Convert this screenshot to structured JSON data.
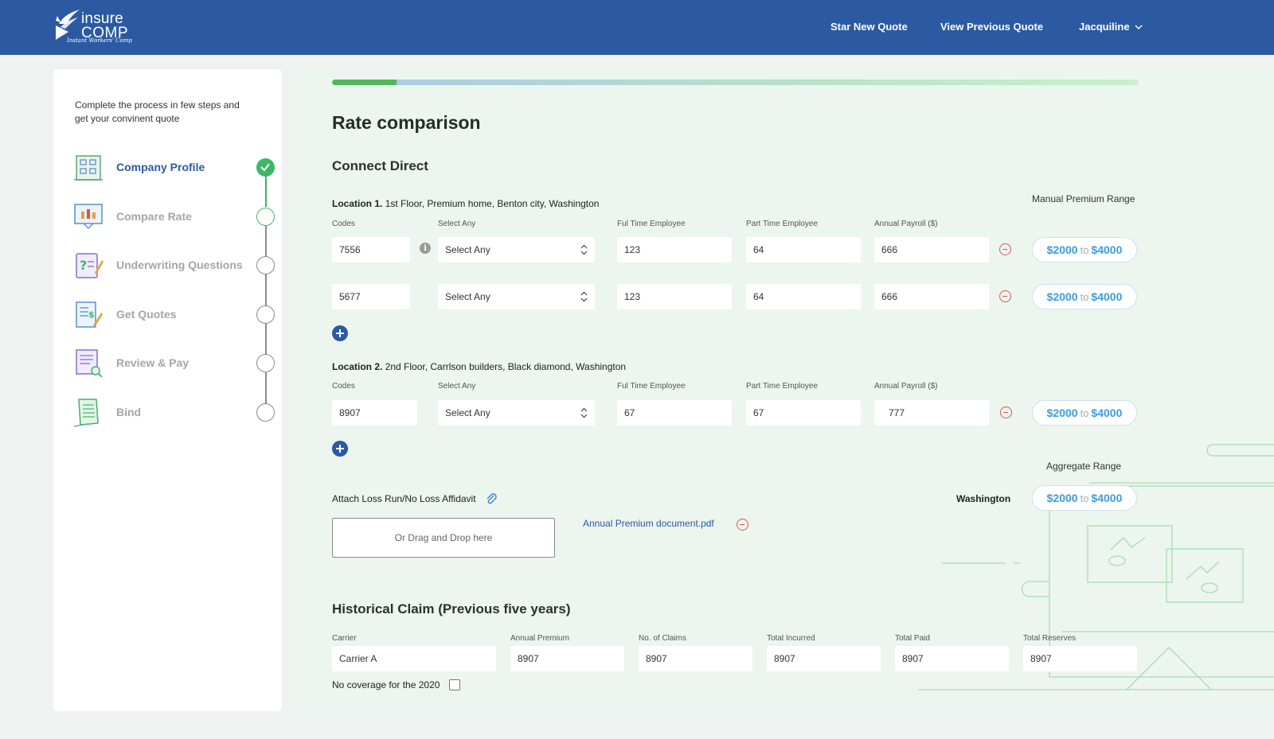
{
  "header": {
    "logo": {
      "top": "insure",
      "bottom": "COMP",
      "tagline": "Instant Workers' Comp"
    },
    "nav": {
      "new_quote": "Star New Quote",
      "prev_quote": "View Previous Quote",
      "user": "Jacquiline"
    }
  },
  "sidebar": {
    "intro": "Complete the process in few steps and get your convinent quote",
    "steps": [
      {
        "label": "Company Profile",
        "status": "completed",
        "icon": "building-icon"
      },
      {
        "label": "Compare Rate",
        "status": "current",
        "icon": "presentation-board-icon"
      },
      {
        "label": "Underwriting Questions",
        "status": "pending",
        "icon": "question-clipboard-icon"
      },
      {
        "label": "Get Quotes",
        "status": "pending",
        "icon": "invoice-pen-icon"
      },
      {
        "label": "Review & Pay",
        "status": "pending",
        "icon": "document-search-icon"
      },
      {
        "label": "Bind",
        "status": "pending",
        "icon": "notebook-icon"
      }
    ]
  },
  "main": {
    "progress_fraction": 0.08,
    "title": "Rate comparison",
    "subtitle": "Connect Direct",
    "manual_premium_range_label": "Manual Premium Range",
    "column_labels": {
      "codes": "Codes",
      "select_any": "Select Any",
      "full_time": "Ful Time Employee",
      "part_time": "Part Time Employee",
      "annual_payroll": "Annual Payroll ($)"
    },
    "locations": [
      {
        "prefix": "Location 1.",
        "address": "1st Floor, Premium home, Benton city, Washington",
        "rows": [
          {
            "code": "7556",
            "select": "Select Any",
            "full_time": "123",
            "part_time": "64",
            "payroll": "666",
            "range_from": "$2000",
            "range_to": "$4000"
          },
          {
            "code": "5677",
            "select": "Select Any",
            "full_time": "123",
            "part_time": "64",
            "payroll": "666",
            "range_from": "$2000",
            "range_to": "$4000"
          }
        ]
      },
      {
        "prefix": "Location 2.",
        "address": "2nd Floor, Carrlson builders, Black diamond, Washington",
        "rows": [
          {
            "code": "8907",
            "select": "Select Any",
            "full_time": "67",
            "part_time": "67",
            "payroll": "777",
            "range_from": "$2000",
            "range_to": "$4000"
          }
        ]
      }
    ],
    "range_connector": "to",
    "aggregate": {
      "label": "Aggregate Range",
      "state": "Washington",
      "from": "$2000",
      "to": "$4000"
    },
    "attach": {
      "label": "Attach Loss Run/No Loss Affidavit",
      "dropzone": "Or Drag and Drop here",
      "file": "Annual Premium document.pdf"
    },
    "historical": {
      "title": "Historical Claim (Previous five years)",
      "labels": {
        "carrier": "Carrier",
        "annual_premium": "Annual Premium",
        "claims": "No. of Claims",
        "incurred": "Total Incurred",
        "paid": "Total Paid",
        "reserves": "Total Reserves"
      },
      "values": {
        "carrier": "Carrier A",
        "annual_premium": "8907",
        "claims": "8907",
        "incurred": "8907",
        "paid": "8907",
        "reserves": "8907"
      },
      "no_coverage": "No coverage for the 2020"
    }
  },
  "colors": {
    "brand": "#2b5aa3",
    "success": "#3fb668",
    "accent": "#3b9be0",
    "danger": "#d35b5b"
  }
}
